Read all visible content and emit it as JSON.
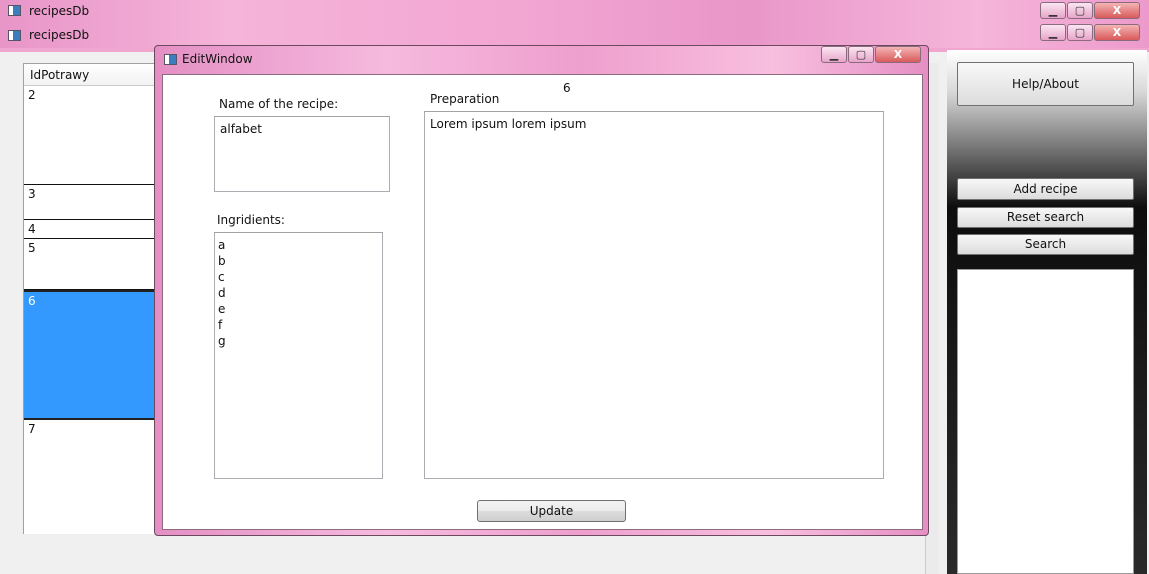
{
  "bg_window": {
    "title": "recipesDb"
  },
  "main_window": {
    "title": "recipesDb"
  },
  "window_controls": {
    "minimize": "▁",
    "maximize": "▢",
    "close": "X"
  },
  "grid": {
    "column_header": "IdPotrawy",
    "rows": [
      "2",
      "3",
      "4",
      "5",
      "6",
      "7"
    ],
    "selected_row": "6"
  },
  "sidebar": {
    "help_label": "Help/About",
    "add_label": "Add recipe",
    "reset_label": "Reset search",
    "search_label": "Search"
  },
  "edit_window": {
    "title": "EditWindow",
    "id_value": "6",
    "name_label": "Name of the recipe:",
    "name_value": "alfabet",
    "preparation_label": "Preparation",
    "preparation_value": "Lorem ipsum lorem ipsum",
    "ingredients_label": "Ingridients:",
    "ingredients": [
      "a",
      "b",
      "c",
      "d",
      "e",
      "f",
      "g"
    ],
    "update_label": "Update"
  },
  "colors": {
    "title_pink": "#f2a6d2",
    "selection_blue": "#3399ff",
    "close_red": "#d85a5a"
  }
}
